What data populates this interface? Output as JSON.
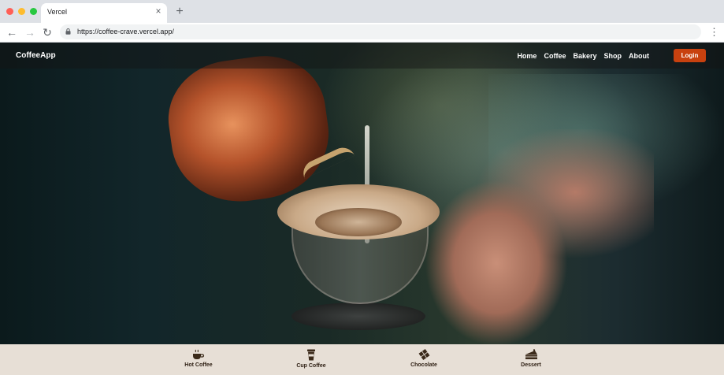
{
  "browser": {
    "tab_title": "Vercel",
    "url": "https://coffee-crave.vercel.app/",
    "colors": {
      "close": "#ff5f57",
      "minimize": "#febc2e",
      "maximize": "#28c840"
    }
  },
  "header": {
    "brand": "CoffeeApp",
    "nav": [
      "Home",
      "Coffee",
      "Bakery",
      "Shop",
      "About"
    ],
    "login_label": "Login",
    "login_color": "#c8410f"
  },
  "categories": [
    {
      "label": "Hot Coffee",
      "icon": "hot-coffee-icon"
    },
    {
      "label": "Cup Coffee",
      "icon": "cup-coffee-icon"
    },
    {
      "label": "Chocolate",
      "icon": "chocolate-icon"
    },
    {
      "label": "Dessert",
      "icon": "dessert-icon"
    }
  ]
}
